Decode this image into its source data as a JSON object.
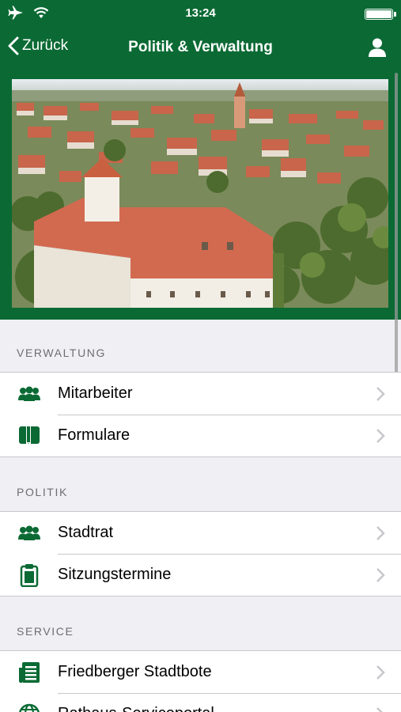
{
  "status": {
    "time": "13:24"
  },
  "nav": {
    "back_label": "Zurück",
    "title": "Politik & Verwaltung"
  },
  "colors": {
    "brand_green": "#0b6a34",
    "separator": "#c8c7cc",
    "section_text": "#6d6d72"
  },
  "sections": [
    {
      "header": "VERWALTUNG",
      "items": [
        {
          "label": "Mitarbeiter",
          "icon": "people-icon"
        },
        {
          "label": "Formulare",
          "icon": "book-icon"
        }
      ]
    },
    {
      "header": "POLITIK",
      "items": [
        {
          "label": "Stadtrat",
          "icon": "people-icon"
        },
        {
          "label": "Sitzungstermine",
          "icon": "clipboard-icon"
        }
      ]
    },
    {
      "header": "SERVICE",
      "items": [
        {
          "label": "Friedberger Stadtbote",
          "icon": "newspaper-icon"
        },
        {
          "label": "Rathaus-Serviceportal",
          "icon": "globe-icon"
        }
      ]
    }
  ]
}
